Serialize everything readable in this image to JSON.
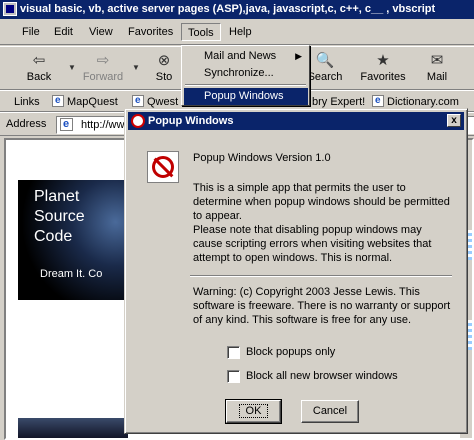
{
  "window": {
    "title": "visual basic, vb, active server pages (ASP),java, javascript,c, c++, c__ , vbscript"
  },
  "menubar": [
    "File",
    "Edit",
    "View",
    "Favorites",
    "Tools",
    "Help"
  ],
  "tools_menu": {
    "items": [
      {
        "label": "Mail and News",
        "submenu": true
      },
      {
        "label": "Synchronize..."
      },
      {
        "label": "Popup Windows",
        "highlighted": true
      }
    ]
  },
  "toolbar": {
    "back": "Back",
    "forward": "Forward",
    "stop": "Sto",
    "search": "Search",
    "favorites": "Favorites",
    "mail": "Mail"
  },
  "links_bar": {
    "label": "Links",
    "items": [
      "MapQuest",
      "Qwest",
      "bry Expert!",
      "Dictionary.com"
    ]
  },
  "address": {
    "label": "Address",
    "value": "http://ww"
  },
  "web_content": {
    "logo_lines": [
      "Planet",
      "Source",
      "Code"
    ],
    "logo_tagline": "Dream It.  Co"
  },
  "dialog": {
    "title": "Popup Windows",
    "close": "x",
    "version": "Popup Windows Version 1.0",
    "description": "This is a simple app that permits the user to determine when popup windows should be permitted to appear.",
    "note": "Please note that disabling popup windows may cause scripting errors when visiting websites that attempt to open windows.  This is normal.",
    "warning": "Warning: (c) Copyright 2003 Jesse Lewis.  This software is freeware.  There is no warranty or support of any kind.  This software is free for any use.",
    "checkboxes": {
      "block_popups": {
        "label": "Block popups only",
        "checked": false
      },
      "block_all": {
        "label": "Block all new browser windows",
        "checked": false
      }
    },
    "ok": "OK",
    "cancel": "Cancel"
  }
}
